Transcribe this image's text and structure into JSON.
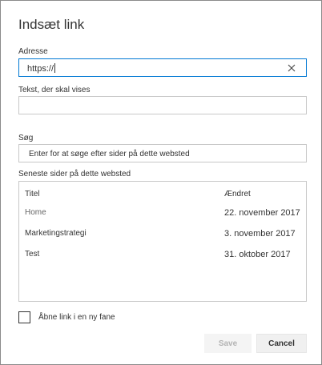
{
  "dialog": {
    "title": "Indsæt link"
  },
  "address": {
    "label": "Adresse",
    "value": "https://"
  },
  "display_text": {
    "label": "Tekst, der skal vises",
    "value": ""
  },
  "search": {
    "label": "Søg",
    "placeholder": "Enter for at søge efter sider på dette websted"
  },
  "recent": {
    "label": "Seneste sider på dette websted",
    "columns": {
      "title": "Titel",
      "modified": "Ændret"
    },
    "rows": [
      {
        "title": "Home",
        "modified": "22. november 2017",
        "title_color": "#666666"
      },
      {
        "title": "Marketingstrategi",
        "modified": "3. november 2017",
        "title_color": "#333333"
      },
      {
        "title": "Test",
        "modified": "31. oktober 2017",
        "title_color": "#333333"
      }
    ]
  },
  "new_tab": {
    "label": "Åbne link i en ny fane",
    "checked": false
  },
  "buttons": {
    "save": "Save",
    "cancel": "Cancel"
  },
  "icons": {
    "clear": "close-icon"
  },
  "colors": {
    "focus_border": "#0078d4",
    "disabled_text": "#b3b3b3"
  }
}
